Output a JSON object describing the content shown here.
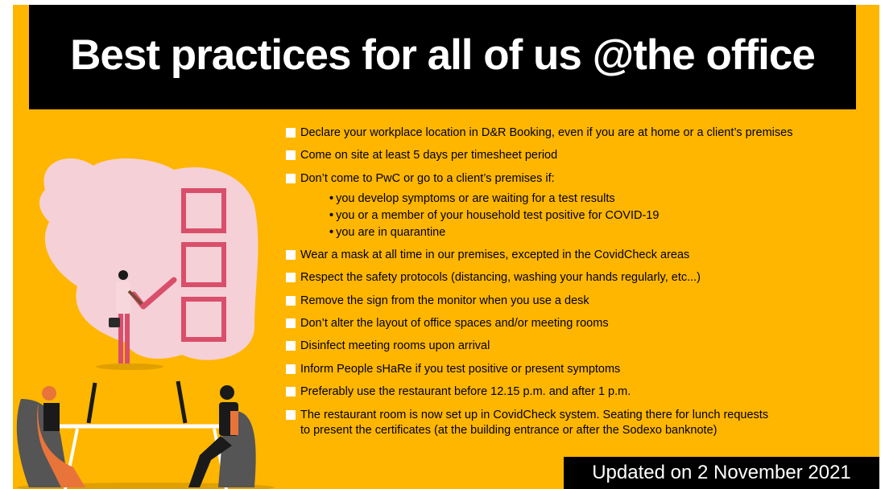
{
  "title": "Best practices for all of us @the office",
  "items": [
    "Declare your workplace location in D&R Booking, even if you are at home or a client’s premises",
    "Come on site at least 5 days per timesheet period",
    "Don’t come to PwC or go to a client’s premises if:",
    "Wear a mask at all time in our premises, excepted in the CovidCheck areas",
    "Respect the safety protocols (distancing, washing your hands regularly, etc...)",
    "Remove the sign from the monitor when you use a desk",
    "Don’t alter the layout of office spaces and/or meeting rooms",
    "Disinfect meeting rooms upon arrival",
    "Inform People sHaRe if you test positive or present symptoms",
    "Preferably use the restaurant before 12.15 p.m. and after 1 p.m.",
    "The restaurant room is now set up in CovidCheck system. Seating there for lunch requests"
  ],
  "last_item_line2": "to present the certificates (at the building entrance or after the Sodexo banknote)",
  "sub_items": [
    "you develop symptoms or are waiting for a test results",
    "you or a member of your household test positive for COVID-19",
    "you are in quarantine"
  ],
  "updated": "Updated on 2 November 2021",
  "colors": {
    "background": "#ffb600",
    "title_bar": "#000000",
    "checkbox_accent": "#d94f6b",
    "blob": "#f5d0d6"
  }
}
